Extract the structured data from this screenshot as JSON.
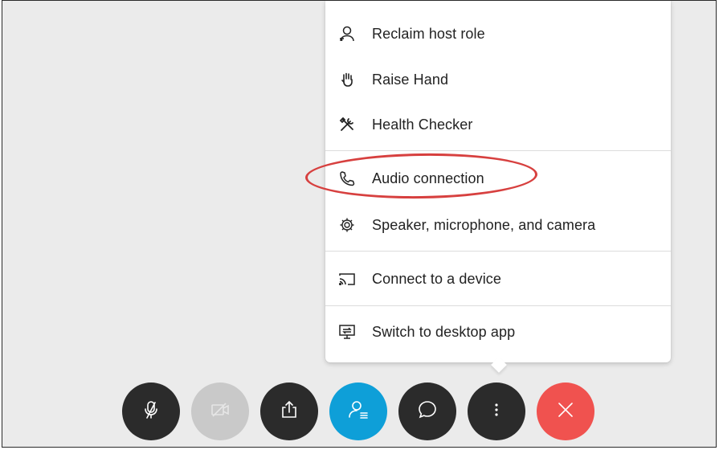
{
  "menu": {
    "items": [
      {
        "label": "Reclaim host role",
        "icon": "person-key-icon"
      },
      {
        "label": "Raise Hand",
        "icon": "hand-icon"
      },
      {
        "label": "Health Checker",
        "icon": "tools-icon"
      },
      {
        "label": "Audio connection",
        "icon": "phone-icon"
      },
      {
        "label": "Speaker, microphone, and camera",
        "icon": "gear-icon"
      },
      {
        "label": "Connect to a device",
        "icon": "cast-icon"
      },
      {
        "label": "Switch to desktop app",
        "icon": "desktop-switch-icon"
      }
    ],
    "highlighted_item": "Audio connection",
    "highlight_color": "#d7403f"
  },
  "toolbar": {
    "buttons": [
      {
        "name": "mute",
        "icon": "microphone-muted-icon",
        "color": "#2b2b2b",
        "enabled": true
      },
      {
        "name": "video",
        "icon": "camera-off-icon",
        "color": "#c9c9c9",
        "enabled": false
      },
      {
        "name": "share",
        "icon": "share-icon",
        "color": "#2b2b2b",
        "enabled": true
      },
      {
        "name": "participants",
        "icon": "participants-icon",
        "color": "#0e9fd8",
        "enabled": true
      },
      {
        "name": "chat",
        "icon": "chat-icon",
        "color": "#2b2b2b",
        "enabled": true
      },
      {
        "name": "more",
        "icon": "more-options-icon",
        "color": "#2b2b2b",
        "enabled": true
      },
      {
        "name": "leave",
        "icon": "close-icon",
        "color": "#f0524f",
        "enabled": true
      }
    ]
  },
  "colors": {
    "stage_background": "#ebebeb",
    "menu_background": "#ffffff",
    "text": "#222222"
  }
}
